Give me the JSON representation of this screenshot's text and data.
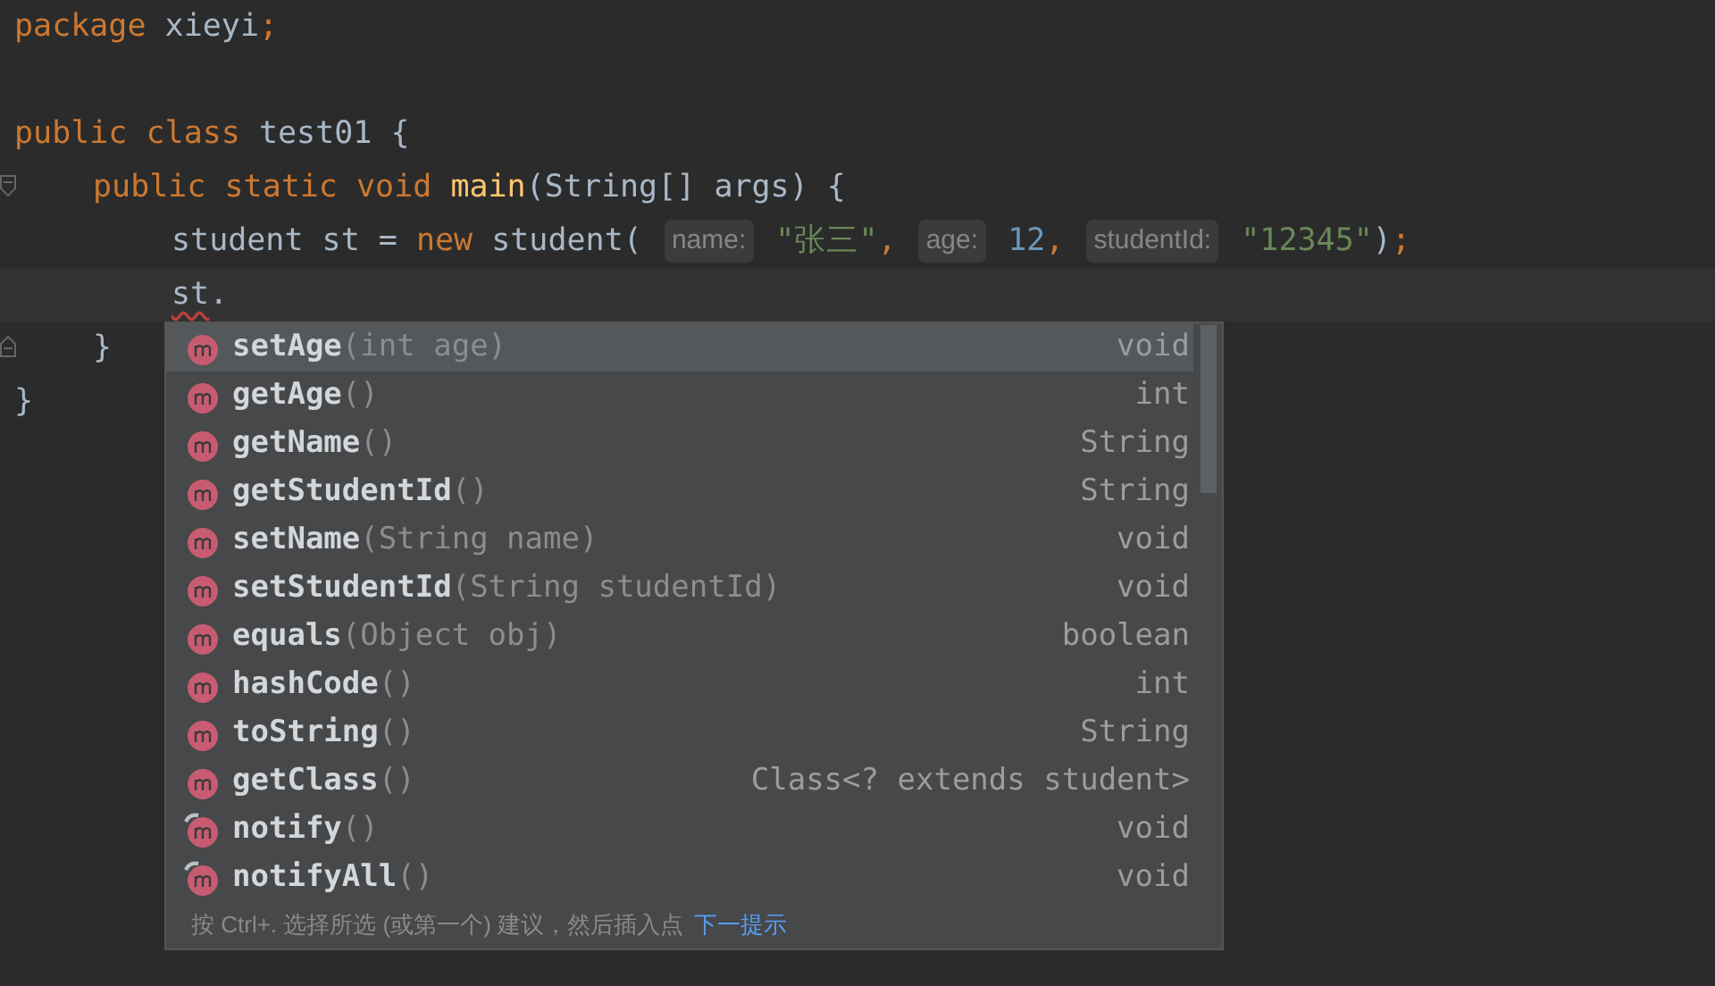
{
  "code_lines": [
    {
      "kind": "code",
      "tokens": [
        {
          "kind": "keyword",
          "text": "package"
        },
        {
          "kind": "plain",
          "text": " xieyi"
        },
        {
          "kind": "keyword",
          "text": ";"
        }
      ]
    },
    {
      "kind": "blank"
    },
    {
      "kind": "code",
      "tokens": [
        {
          "kind": "keyword",
          "text": "public class"
        },
        {
          "kind": "plain",
          "text": " test01 {"
        }
      ],
      "children": [
        {
          "kind": "code",
          "fold_marker": true,
          "tokens": [
            {
              "kind": "keyword",
              "text": "public static void"
            },
            {
              "kind": "method",
              "text": " main"
            },
            {
              "kind": "plain",
              "text": "(String[] args) {"
            }
          ],
          "children": [
            {
              "kind": "code",
              "tokens": [
                {
                  "kind": "plain",
                  "text": "student st = "
                },
                {
                  "kind": "keyword",
                  "text": "new"
                },
                {
                  "kind": "plain",
                  "text": " student( "
                },
                {
                  "kind": "hint",
                  "text": "name:"
                },
                {
                  "kind": "string",
                  "text": " \"张三\""
                },
                {
                  "kind": "keyword",
                  "text": ", "
                },
                {
                  "kind": "hint",
                  "text": "age:"
                },
                {
                  "kind": "number",
                  "text": " 12"
                },
                {
                  "kind": "keyword",
                  "text": ", "
                },
                {
                  "kind": "hint",
                  "text": "studentId:"
                },
                {
                  "kind": "string",
                  "text": " \"12345\""
                },
                {
                  "kind": "plain",
                  "text": ")"
                },
                {
                  "kind": "keyword",
                  "text": ";"
                }
              ]
            },
            {
              "kind": "code",
              "current": true,
              "tokens": [
                {
                  "kind": "error",
                  "text": "st"
                },
                {
                  "kind": "plain",
                  "text": "."
                }
              ]
            }
          ]
        },
        {
          "kind": "code",
          "fold_marker": true,
          "tokens": [
            {
              "kind": "plain",
              "text": "}"
            }
          ]
        }
      ]
    },
    {
      "kind": "code",
      "tokens": [
        {
          "kind": "plain",
          "text": "}"
        }
      ]
    }
  ],
  "completion": {
    "items": [
      {
        "name": "setAge",
        "params": "(int age)",
        "type": "void",
        "selected": true,
        "final": false
      },
      {
        "name": "getAge",
        "params": "()",
        "type": "int",
        "selected": false,
        "final": false
      },
      {
        "name": "getName",
        "params": "()",
        "type": "String",
        "selected": false,
        "final": false
      },
      {
        "name": "getStudentId",
        "params": "()",
        "type": "String",
        "selected": false,
        "final": false
      },
      {
        "name": "setName",
        "params": "(String name)",
        "type": "void",
        "selected": false,
        "final": false
      },
      {
        "name": "setStudentId",
        "params": "(String studentId)",
        "type": "void",
        "selected": false,
        "final": false
      },
      {
        "name": "equals",
        "params": "(Object obj)",
        "type": "boolean",
        "selected": false,
        "final": false
      },
      {
        "name": "hashCode",
        "params": "()",
        "type": "int",
        "selected": false,
        "final": false
      },
      {
        "name": "toString",
        "params": "()",
        "type": "String",
        "selected": false,
        "final": false
      },
      {
        "name": "getClass",
        "params": "()",
        "type": "Class<? extends student>",
        "selected": false,
        "final": false
      },
      {
        "name": "notify",
        "params": "()",
        "type": "void",
        "selected": false,
        "final": true
      },
      {
        "name": "notifyAll",
        "params": "()",
        "type": "void",
        "selected": false,
        "final": true
      }
    ],
    "hint_text": "按 Ctrl+. 选择所选 (或第一个) 建议，然后插入点",
    "hint_link": "下一提示"
  }
}
